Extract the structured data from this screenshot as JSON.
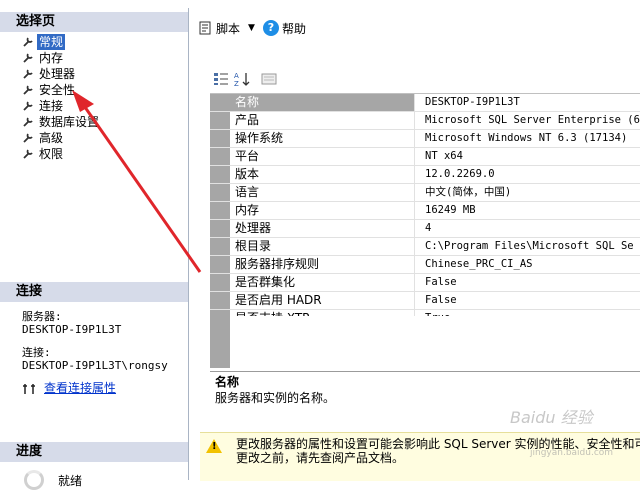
{
  "sidebar": {
    "select_page_header": "选择页",
    "items": [
      {
        "label": "常规",
        "selected": true
      },
      {
        "label": "内存"
      },
      {
        "label": "处理器"
      },
      {
        "label": "安全性"
      },
      {
        "label": "连接"
      },
      {
        "label": "数据库设置"
      },
      {
        "label": "高级"
      },
      {
        "label": "权限"
      }
    ],
    "connection_header": "连接",
    "server_label": "服务器:",
    "server_value": "DESKTOP-I9P1L3T",
    "connection_label": "连接:",
    "connection_value": "DESKTOP-I9P1L3T\\rongsy",
    "view_connection_link": "查看连接属性",
    "progress_header": "进度",
    "progress_status": "就绪"
  },
  "toolbar": {
    "script_label": "脚本",
    "help_label": "帮助"
  },
  "properties": [
    {
      "name": "名称",
      "value": "DESKTOP-I9P1L3T"
    },
    {
      "name": "产品",
      "value": "Microsoft SQL Server Enterprise (6"
    },
    {
      "name": "操作系统",
      "value": "Microsoft Windows NT 6.3 (17134)"
    },
    {
      "name": "平台",
      "value": "NT x64"
    },
    {
      "name": "版本",
      "value": "12.0.2269.0"
    },
    {
      "name": "语言",
      "value": "中文(简体，中国)"
    },
    {
      "name": "内存",
      "value": "16249 MB"
    },
    {
      "name": "处理器",
      "value": "4"
    },
    {
      "name": "根目录",
      "value": "C:\\Program Files\\Microsoft SQL Se"
    },
    {
      "name": "服务器排序规则",
      "value": "Chinese_PRC_CI_AS"
    },
    {
      "name": "是否群集化",
      "value": "False"
    },
    {
      "name": "是否启用 HADR",
      "value": "False"
    },
    {
      "name": "是否支持 XTP",
      "value": "True"
    }
  ],
  "description": {
    "title": "名称",
    "text": "服务器和实例的名称。"
  },
  "warning": {
    "line1": "更改服务器的属性和设置可能会影响此 SQL Server 实例的性能、安全性和可",
    "line2": "更改之前，请先查阅产品文档。"
  },
  "watermark": {
    "text": "Baidu 经验",
    "url": "jingyan.baidu.com"
  },
  "colors": {
    "accent": "#316ac5",
    "section_header": "#d6dbe9",
    "arrow": "#e0262b",
    "warning_bg": "#fffde0"
  }
}
